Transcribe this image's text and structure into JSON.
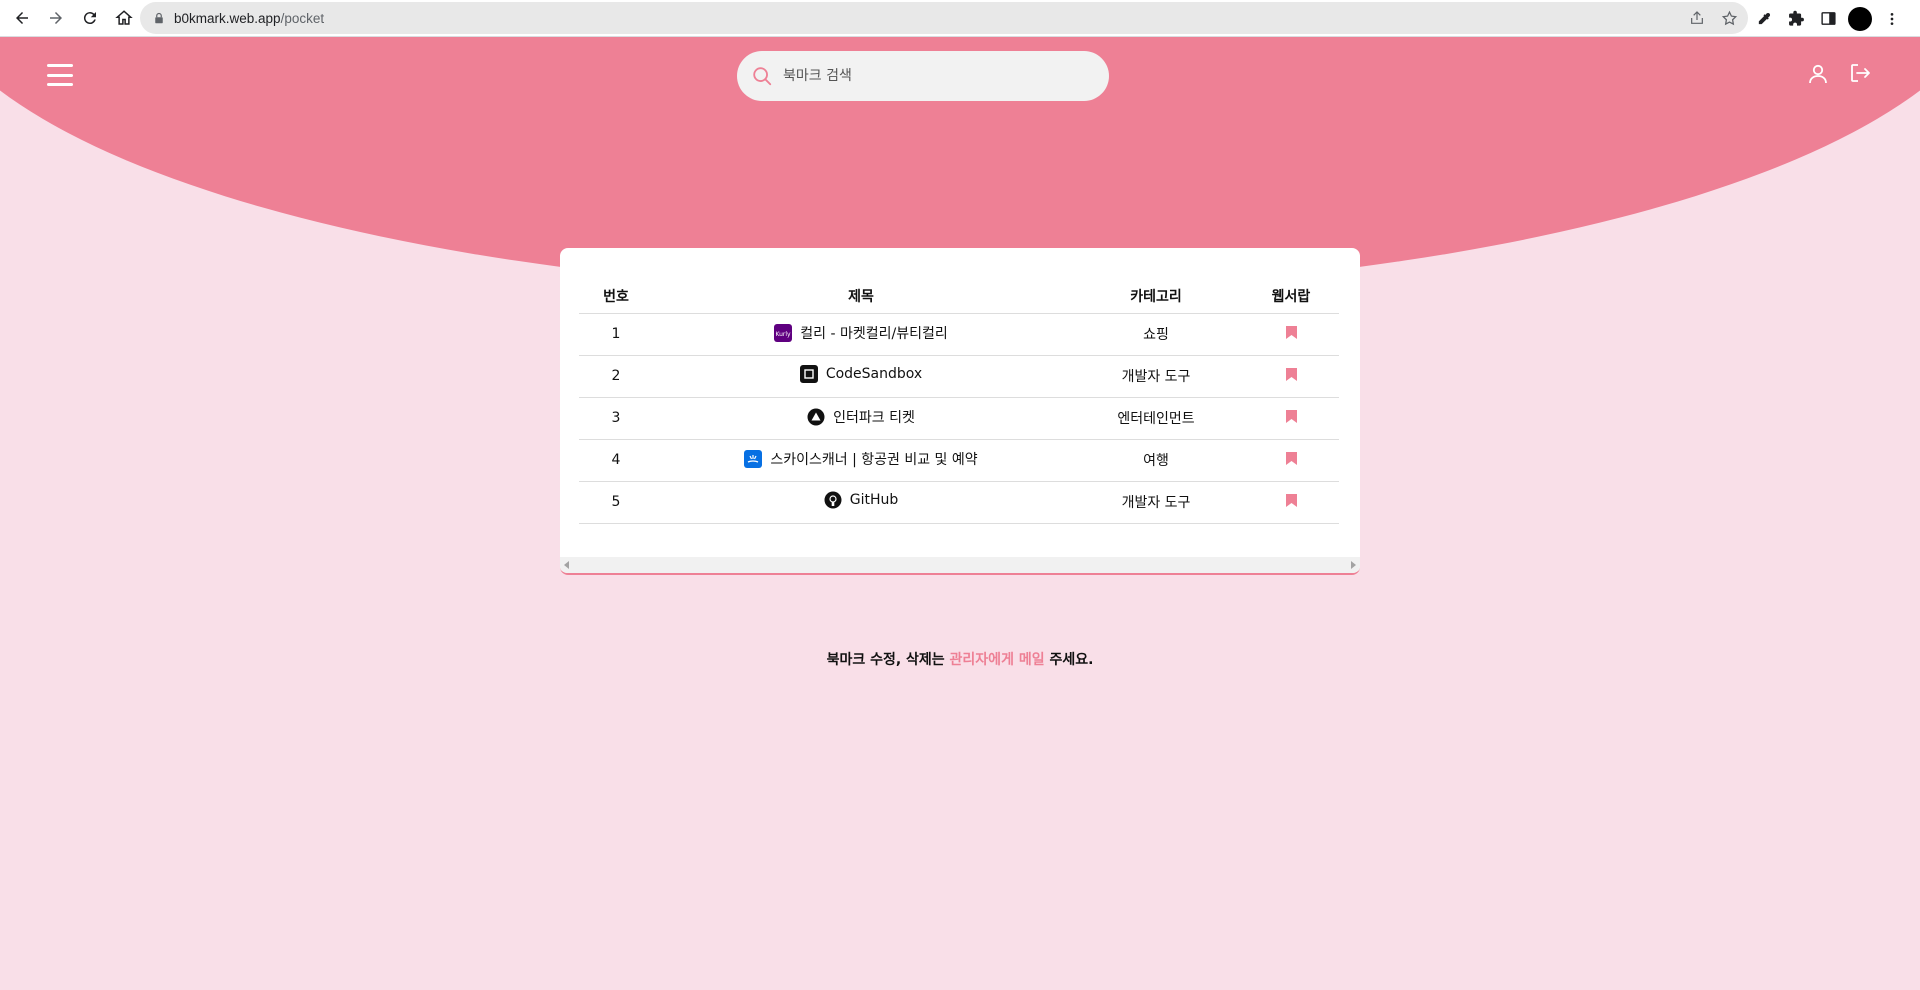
{
  "browser": {
    "url_host": "b0kmark.web.app",
    "url_path": "/pocket"
  },
  "header": {
    "search_placeholder": "북마크 검색"
  },
  "table": {
    "columns": [
      "번호",
      "제목",
      "카테고리",
      "웹서랍"
    ],
    "rows": [
      {
        "num": "1",
        "title": "컬리 - 마켓컬리/뷰티컬리",
        "category": "쇼핑",
        "icon": "kurly-icon"
      },
      {
        "num": "2",
        "title": "CodeSandbox",
        "category": "개발자 도구",
        "icon": "codesandbox-icon"
      },
      {
        "num": "3",
        "title": "인터파크 티켓",
        "category": "엔터테인먼트",
        "icon": "interpark-icon"
      },
      {
        "num": "4",
        "title": "스카이스캐너 | 항공권 비교 및 예약",
        "category": "여행",
        "icon": "skyscanner-icon"
      },
      {
        "num": "5",
        "title": "GitHub",
        "category": "개발자 도구",
        "icon": "github-icon"
      }
    ]
  },
  "notice": {
    "before": "북마크 수정, 삭제는 ",
    "link": "관리자에게 메일",
    "after": " 주세요."
  },
  "colors": {
    "accent": "#ee8095",
    "background": "#f9dfe8"
  }
}
